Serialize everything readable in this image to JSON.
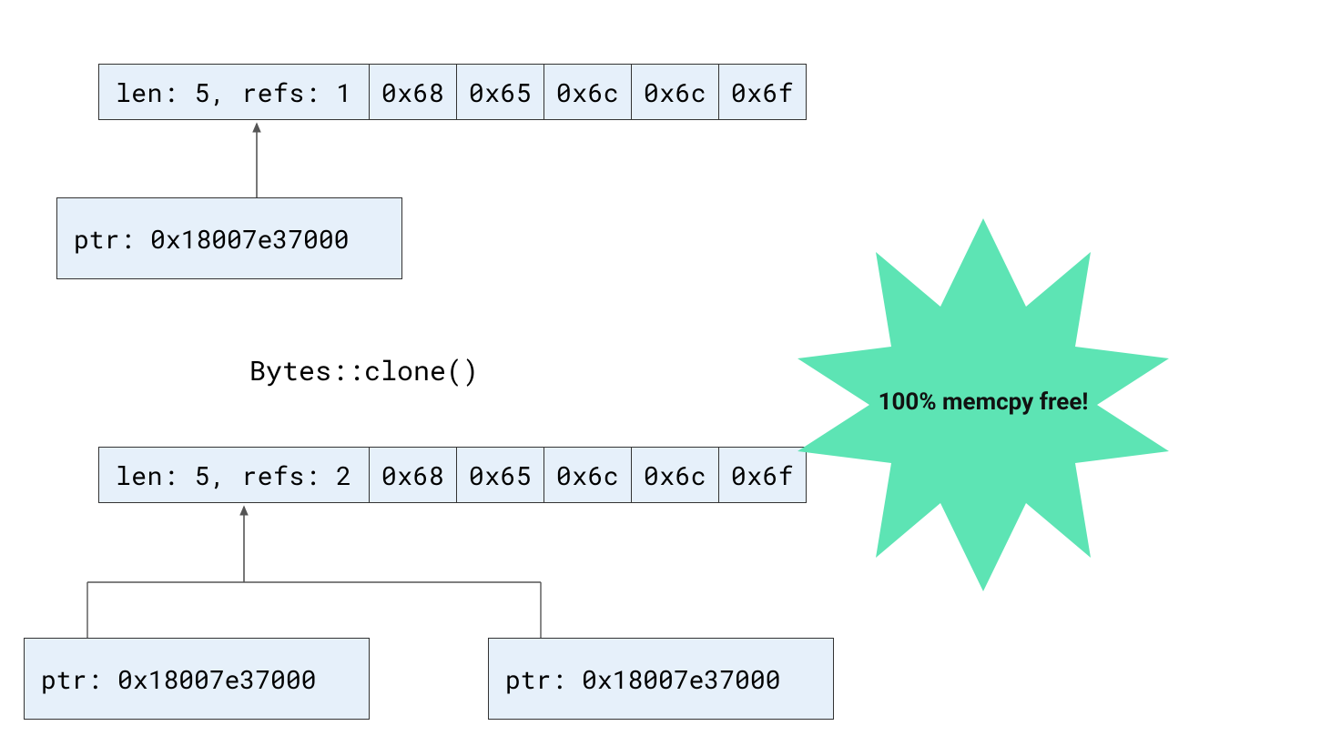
{
  "top_buffer": {
    "header": "len: 5, refs: 1",
    "bytes": [
      "0x68",
      "0x65",
      "0x6c",
      "0x6c",
      "0x6f"
    ]
  },
  "top_ptr": {
    "text": "ptr: 0x18007e37000"
  },
  "middle_label": "Bytes::clone()",
  "bottom_buffer": {
    "header": "len: 5, refs: 2",
    "bytes": [
      "0x68",
      "0x65",
      "0x6c",
      "0x6c",
      "0x6f"
    ]
  },
  "bottom_ptr_left": {
    "text": "ptr: 0x18007e37000"
  },
  "bottom_ptr_right": {
    "text": "ptr: 0x18007e37000"
  },
  "burst": {
    "text": "100% memcpy free!",
    "fill": "#5de4b4"
  }
}
